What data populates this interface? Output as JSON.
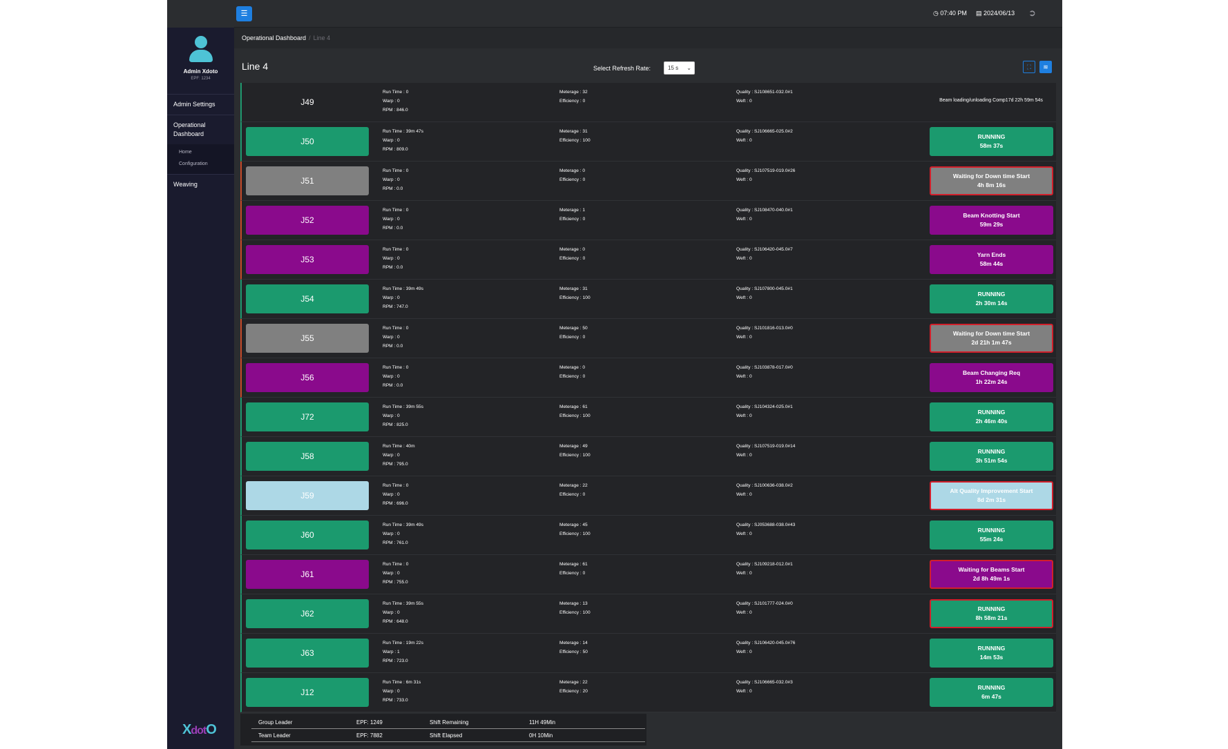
{
  "sidebar": {
    "user_name": "Admin Xdoto",
    "user_epf": "EPF: 1234",
    "nav": {
      "admin_settings": "Admin Settings",
      "operational_dashboard": "Operational Dashboard",
      "home": "Home",
      "configuration": "Configuration",
      "weaving": "Weaving"
    },
    "logo": {
      "x": "X",
      "d": "dot",
      "o": "O"
    }
  },
  "header": {
    "time": "07:40 PM",
    "date": "2024/06/13",
    "menu_icon": "hamburger-icon",
    "clock_icon": "clock-icon",
    "calendar_icon": "calendar-icon",
    "logout_icon": "logout-icon"
  },
  "breadcrumb": {
    "root": "Operational Dashboard",
    "separator": "/",
    "current": "Line 4"
  },
  "page": {
    "title": "Line 4",
    "refresh_label": "Select Refresh Rate:",
    "refresh_value": "15 s"
  },
  "labels": {
    "run_time": "Run Time :",
    "warp": "Warp :",
    "rpm": "RPM :",
    "meterage": "Meterage :",
    "efficiency": "Efficiency :",
    "quality": "Quality :",
    "weft": "Weft :"
  },
  "looms": [
    {
      "id": "J49",
      "run_time": "0",
      "warp": "0",
      "rpm": "846.0",
      "meterage": "32",
      "efficiency": "0",
      "quality": "SJ108651-032.0#1",
      "weft": "0",
      "status_line1": "Beam loading/unloading Comp17d 22h 59m 54s",
      "status_line2": "",
      "color": "plain",
      "edge": "green",
      "status_border": false
    },
    {
      "id": "J50",
      "run_time": "39m 47s",
      "warp": "0",
      "rpm": "809.0",
      "meterage": "31",
      "efficiency": "100",
      "quality": "SJ106665-025.0#2",
      "weft": "0",
      "status_line1": "RUNNING",
      "status_line2": "58m 37s",
      "color": "green",
      "edge": "green",
      "status_border": false
    },
    {
      "id": "J51",
      "run_time": "0",
      "warp": "0",
      "rpm": "0.0",
      "meterage": "0",
      "efficiency": "0",
      "quality": "SJ107519-019.0#26",
      "weft": "0",
      "status_line1": "Waiting for Down time Start",
      "status_line2": "4h 8m 16s",
      "color": "gray",
      "edge": "red",
      "status_border": true
    },
    {
      "id": "J52",
      "run_time": "0",
      "warp": "0",
      "rpm": "0.0",
      "meterage": "1",
      "efficiency": "0",
      "quality": "SJ108470-040.0#1",
      "weft": "0",
      "status_line1": "Beam Knotting Start",
      "status_line2": "59m 29s",
      "color": "purple",
      "edge": "red",
      "status_border": false
    },
    {
      "id": "J53",
      "run_time": "0",
      "warp": "0",
      "rpm": "0.0",
      "meterage": "0",
      "efficiency": "0",
      "quality": "SJ106420-045.0#7",
      "weft": "0",
      "status_line1": "Yarn Ends",
      "status_line2": "58m 44s",
      "color": "purple",
      "edge": "red",
      "status_border": false
    },
    {
      "id": "J54",
      "run_time": "39m 49s",
      "warp": "0",
      "rpm": "747.0",
      "meterage": "31",
      "efficiency": "100",
      "quality": "SJ107800-045.0#1",
      "weft": "0",
      "status_line1": "RUNNING",
      "status_line2": "2h 30m 14s",
      "color": "green",
      "edge": "green",
      "status_border": false
    },
    {
      "id": "J55",
      "run_time": "0",
      "warp": "0",
      "rpm": "0.0",
      "meterage": "50",
      "efficiency": "0",
      "quality": "SJ101816-013.0#0",
      "weft": "0",
      "status_line1": "Waiting for Down time Start",
      "status_line2": "2d 21h 1m 47s",
      "color": "gray",
      "edge": "red",
      "status_border": true
    },
    {
      "id": "J56",
      "run_time": "0",
      "warp": "0",
      "rpm": "0.0",
      "meterage": "0",
      "efficiency": "0",
      "quality": "SJ103878-017.0#0",
      "weft": "0",
      "status_line1": "Beam Changing Req",
      "status_line2": "1h 22m 24s",
      "color": "purple",
      "edge": "red",
      "status_border": false
    },
    {
      "id": "J72",
      "run_time": "39m 55s",
      "warp": "0",
      "rpm": "825.0",
      "meterage": "61",
      "efficiency": "100",
      "quality": "SJ104324-025.0#1",
      "weft": "0",
      "status_line1": "RUNNING",
      "status_line2": "2h 46m 40s",
      "color": "green",
      "edge": "green",
      "status_border": false
    },
    {
      "id": "J58",
      "run_time": "40m",
      "warp": "0",
      "rpm": "795.0",
      "meterage": "49",
      "efficiency": "100",
      "quality": "SJ107519-019.0#14",
      "weft": "0",
      "status_line1": "RUNNING",
      "status_line2": "3h 51m 54s",
      "color": "green",
      "edge": "green",
      "status_border": false
    },
    {
      "id": "J59",
      "run_time": "0",
      "warp": "0",
      "rpm": "696.0",
      "meterage": "22",
      "efficiency": "0",
      "quality": "SJ100636-038.0#2",
      "weft": "0",
      "status_line1": "Alt Quality Improvement Start",
      "status_line2": "8d 2m 31s",
      "color": "lightblue",
      "edge": "green",
      "status_border": true
    },
    {
      "id": "J60",
      "run_time": "39m 49s",
      "warp": "0",
      "rpm": "761.0",
      "meterage": "45",
      "efficiency": "100",
      "quality": "SJ053688-038.0#43",
      "weft": "0",
      "status_line1": "RUNNING",
      "status_line2": "55m 24s",
      "color": "green",
      "edge": "green",
      "status_border": false
    },
    {
      "id": "J61",
      "run_time": "0",
      "warp": "0",
      "rpm": "755.0",
      "meterage": "61",
      "efficiency": "0",
      "quality": "SJ109218-012.0#1",
      "weft": "0",
      "status_line1": "Waiting for Beams Start",
      "status_line2": "2d 8h 49m 1s",
      "color": "purple",
      "edge": "green",
      "status_border": true
    },
    {
      "id": "J62",
      "run_time": "39m 55s",
      "warp": "0",
      "rpm": "648.0",
      "meterage": "13",
      "efficiency": "100",
      "quality": "SJ101777-024.0#0",
      "weft": "0",
      "status_line1": "RUNNING",
      "status_line2": "8h 58m 21s",
      "color": "green",
      "edge": "green",
      "status_border": true
    },
    {
      "id": "J63",
      "run_time": "19m 22s",
      "warp": "1",
      "rpm": "723.0",
      "meterage": "14",
      "efficiency": "50",
      "quality": "SJ106420-045.0#76",
      "weft": "0",
      "status_line1": "RUNNING",
      "status_line2": "14m 53s",
      "color": "green",
      "edge": "green",
      "status_border": false
    },
    {
      "id": "J12",
      "run_time": "6m 31s",
      "warp": "0",
      "rpm": "733.0",
      "meterage": "22",
      "efficiency": "20",
      "quality": "SJ106665-032.0#3",
      "weft": "0",
      "status_line1": "RUNNING",
      "status_line2": "6m 47s",
      "color": "green",
      "edge": "green",
      "status_border": false
    }
  ],
  "footer": {
    "rows": [
      {
        "role": "Group Leader",
        "epf": "EPF: 1249",
        "shift_label": "Shift Remaining",
        "shift_value": "11H 49Min"
      },
      {
        "role": "Team Leader",
        "epf": "EPF: 7882",
        "shift_label": "Shift Elapsed",
        "shift_value": "0H 10Min"
      }
    ]
  },
  "colors": {
    "running": "#1b9a6e",
    "downtime": "#808080",
    "beam": "#8a0a8c",
    "quality": "#add8e6",
    "accent": "#1e7fe0",
    "alert_border": "#d21f2b"
  }
}
